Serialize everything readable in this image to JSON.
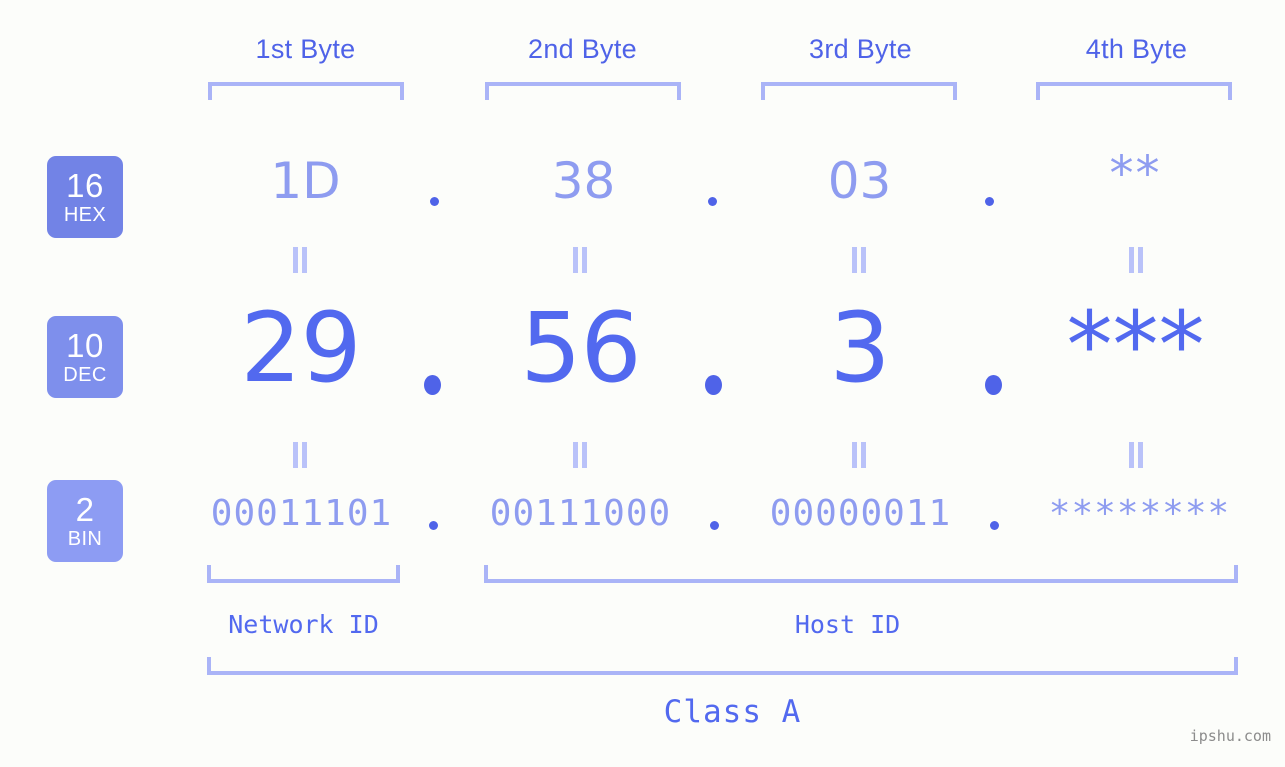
{
  "accent": {
    "strong_blue": "#4f63e8",
    "medium_blue": "#5269ef",
    "light_periwinkle": "#8e9cf0",
    "bracket": "#aab4f7",
    "badge_bg": "#7b8ce8",
    "background": "#fcfdfa",
    "watermark_gray": "#8c8c8c"
  },
  "byte_headers": [
    {
      "label": "1st Byte"
    },
    {
      "label": "2nd Byte"
    },
    {
      "label": "3rd Byte"
    },
    {
      "label": "4th Byte"
    }
  ],
  "bases": [
    {
      "num": "16",
      "abbr": "HEX"
    },
    {
      "num": "10",
      "abbr": "DEC"
    },
    {
      "num": "2",
      "abbr": "BIN"
    }
  ],
  "rows": {
    "hex": {
      "base_number": "16",
      "base_abbr": "HEX",
      "values": [
        "1D",
        "38",
        "03",
        "**"
      ],
      "separator": "."
    },
    "dec": {
      "base_number": "10",
      "base_abbr": "DEC",
      "values": [
        "29",
        "56",
        "3",
        "***"
      ],
      "separator": "."
    },
    "bin": {
      "base_number": "2",
      "base_abbr": "BIN",
      "values": [
        "00011101",
        "00111000",
        "00000011",
        "********"
      ],
      "separator": "."
    }
  },
  "equality_symbol": "=",
  "id_sections": [
    {
      "label": "Network ID"
    },
    {
      "label": "Host ID"
    }
  ],
  "class_label": "Class A",
  "watermark": "ipshu.com"
}
